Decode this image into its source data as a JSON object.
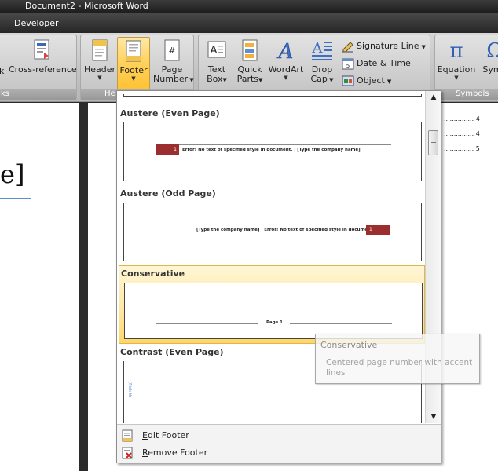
{
  "window": {
    "title": "Document2 - Microsoft Word"
  },
  "tabs": [
    {
      "label": "Developer"
    }
  ],
  "ribbon": {
    "links_group": {
      "label": "ks",
      "cross_reference": "Cross-reference",
      "partial_button": "k"
    },
    "header_footer_group": {
      "label": "He",
      "header": "Header",
      "footer": "Footer",
      "page_number_1": "Page",
      "page_number_2": "Number"
    },
    "text_group": {
      "text_box_1": "Text",
      "text_box_2": "Box",
      "quick_parts_1": "Quick",
      "quick_parts_2": "Parts",
      "wordart": "WordArt",
      "drop_cap_1": "Drop",
      "drop_cap_2": "Cap",
      "signature_line": "Signature Line",
      "date_time": "Date & Time",
      "object": "Object"
    },
    "symbols_group": {
      "label": "Symbols",
      "equation": "Equation",
      "symbol_partial": "Symb"
    }
  },
  "document": {
    "visible_char": "e]",
    "toc_numbers": [
      "4",
      "4",
      "5"
    ]
  },
  "gallery": {
    "items": [
      {
        "title": "Austere (Even Page)",
        "page_num": "1",
        "text": "Error! No text of specified style in document.  |  [Type the company name]"
      },
      {
        "title": "Austere (Odd Page)",
        "page_num": "1",
        "text": "[Type the company name]  |  Error! No text of specified style in document."
      },
      {
        "title": "Conservative",
        "text": "Page 1"
      },
      {
        "title": "Contrast (Even Page)",
        "vertical_text": "[Pick th"
      }
    ],
    "menu": {
      "edit_footer_first": "E",
      "edit_footer_rest": "dit Footer",
      "remove_footer_first": "R",
      "remove_footer_rest": "emove Footer"
    }
  },
  "tooltip": {
    "title": "Conservative",
    "body": "Centered page number with accent lines"
  }
}
